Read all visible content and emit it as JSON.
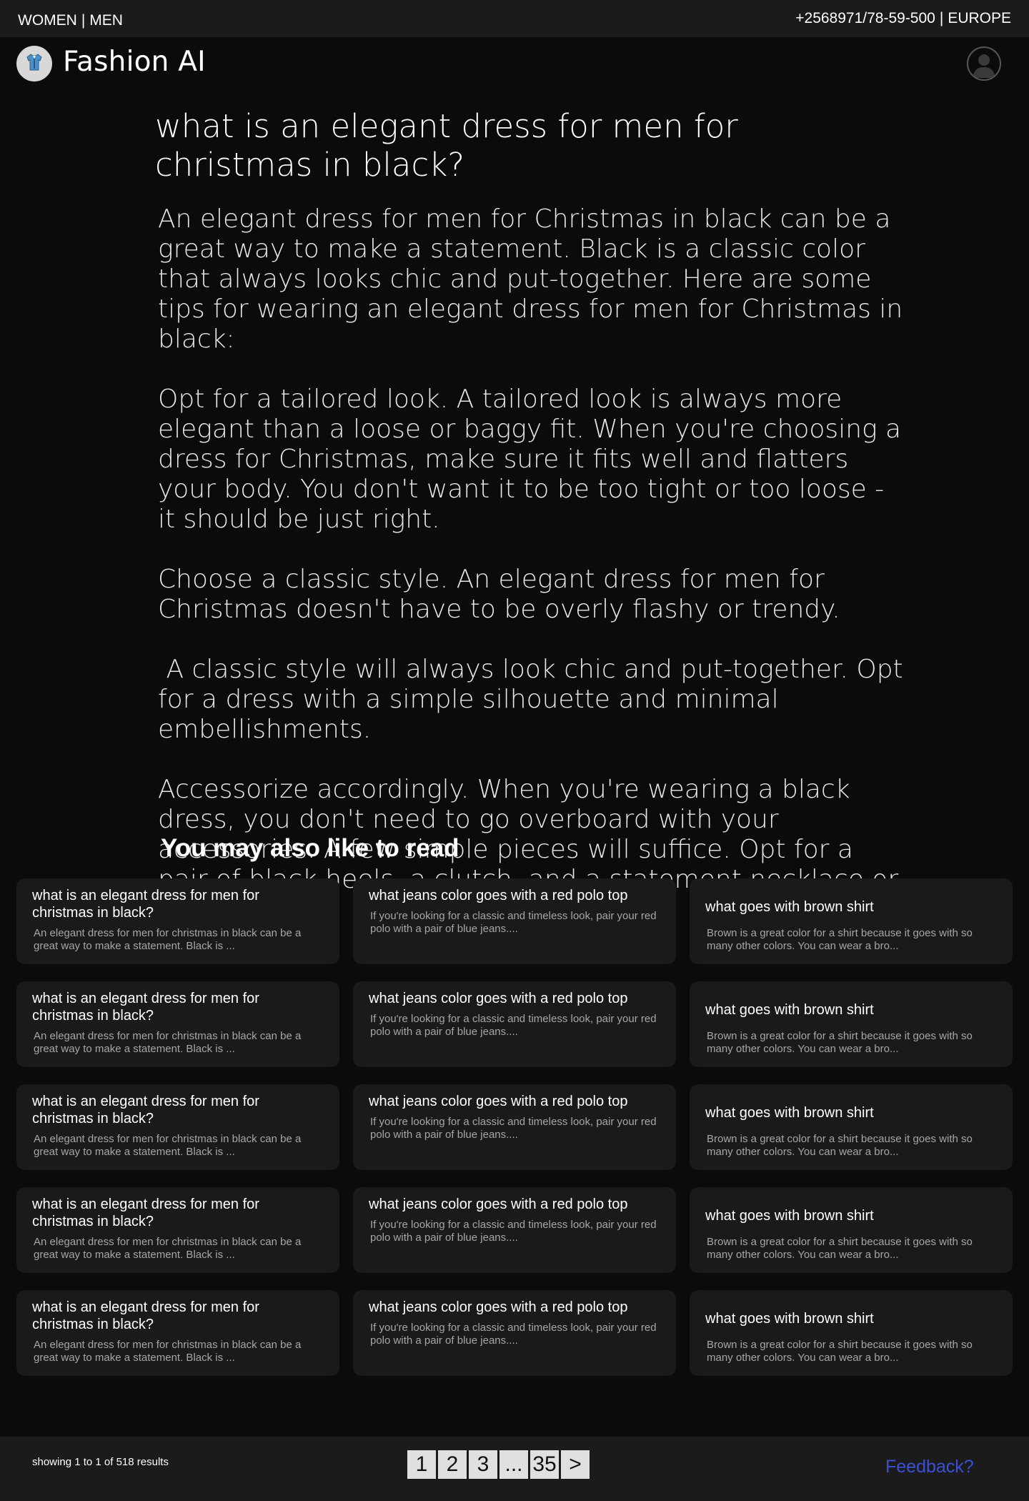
{
  "topbar": {
    "nav": [
      "WOMEN",
      "MEN"
    ],
    "phone": "+2568971/78-59-500",
    "region": "EUROPE"
  },
  "header": {
    "brand": "Fashion AI",
    "logo_icon": "shirt-icon",
    "avatar_icon": "user-avatar-icon"
  },
  "article": {
    "question": "what is an elegant dress for men for christmas in black?",
    "paragraphs": [
      "An elegant dress for men for Christmas in black can be a great way to make a statement. Black is a classic color that always looks chic and put-together. Here are some tips for wearing an elegant dress for men for Christmas in black:",
      "Opt for a tailored look. A tailored look is always more elegant than a loose or baggy fit. When you're choosing a dress for Christmas, make sure it fits well and flatters your body. You don't want it to be too tight or too loose - it should be just right.",
      "Choose a classic style. An elegant dress for men for Christmas doesn't have to be overly flashy or trendy.",
      " A classic style will always look chic and put-together. Opt for a dress with a simple silhouette and minimal embellishments.",
      "Accessorize accordingly. When you're wearing a black dress, you don't need to go overboard with your accessories. A few simple pieces will suffice. Opt for a pair of black heels, a clutch, and a statement necklace or earrings."
    ]
  },
  "related": {
    "heading": "You may also like to read",
    "cards": [
      {
        "title": "what is an elegant dress for men for christmas in black?",
        "snippet": "An elegant dress for men for christmas in black can be a great way to make a statement. Black is ..."
      },
      {
        "title": "what jeans color goes with a red polo top",
        "snippet": "If you're looking for a classic and timeless look, pair your red polo with a pair of blue jeans...."
      },
      {
        "title": "what goes with brown shirt",
        "snippet": "Brown is a great color for a shirt because it goes with so many other colors. You can wear a bro..."
      },
      {
        "title": "what is an elegant dress for men for christmas in black?",
        "snippet": "An elegant dress for men for christmas in black can be a great way to make a statement. Black is ..."
      },
      {
        "title": "what jeans color goes with a red polo top",
        "snippet": "If you're looking for a classic and timeless look, pair your red polo with a pair of blue jeans...."
      },
      {
        "title": "what goes with brown shirt",
        "snippet": "Brown is a great color for a shirt because it goes with so many other colors. You can wear a bro..."
      },
      {
        "title": "what is an elegant dress for men for christmas in black?",
        "snippet": "An elegant dress for men for christmas in black can be a great way to make a statement. Black is ..."
      },
      {
        "title": "what jeans color goes with a red polo top",
        "snippet": "If you're looking for a classic and timeless look, pair your red polo with a pair of blue jeans...."
      },
      {
        "title": "what goes with brown shirt",
        "snippet": "Brown is a great color for a shirt because it goes with so many other colors. You can wear a bro..."
      },
      {
        "title": "what is an elegant dress for men for christmas in black?",
        "snippet": "An elegant dress for men for christmas in black can be a great way to make a statement. Black is ..."
      },
      {
        "title": "what jeans color goes with a red polo top",
        "snippet": "If you're looking for a classic and timeless look, pair your red polo with a pair of blue jeans...."
      },
      {
        "title": "what goes with brown shirt",
        "snippet": "Brown is a great color for a shirt because it goes with so many other colors. You can wear a bro..."
      },
      {
        "title": "what is an elegant dress for men for christmas in black?",
        "snippet": "An elegant dress for men for christmas in black can be a great way to make a statement. Black is ..."
      },
      {
        "title": "what jeans color goes with a red polo top",
        "snippet": "If you're looking for a classic and timeless look, pair your red polo with a pair of blue jeans...."
      },
      {
        "title": "what goes with brown shirt",
        "snippet": "Brown is a great color for a shirt because it goes with so many other colors. You can wear a bro..."
      }
    ]
  },
  "footer": {
    "results_text": "showing 1 to 1 of 518 results",
    "pages": [
      "1",
      "2",
      "3",
      "...",
      "35",
      ">"
    ],
    "feedback": "Feedback?",
    "feedback_color": "#3c4fd6"
  }
}
